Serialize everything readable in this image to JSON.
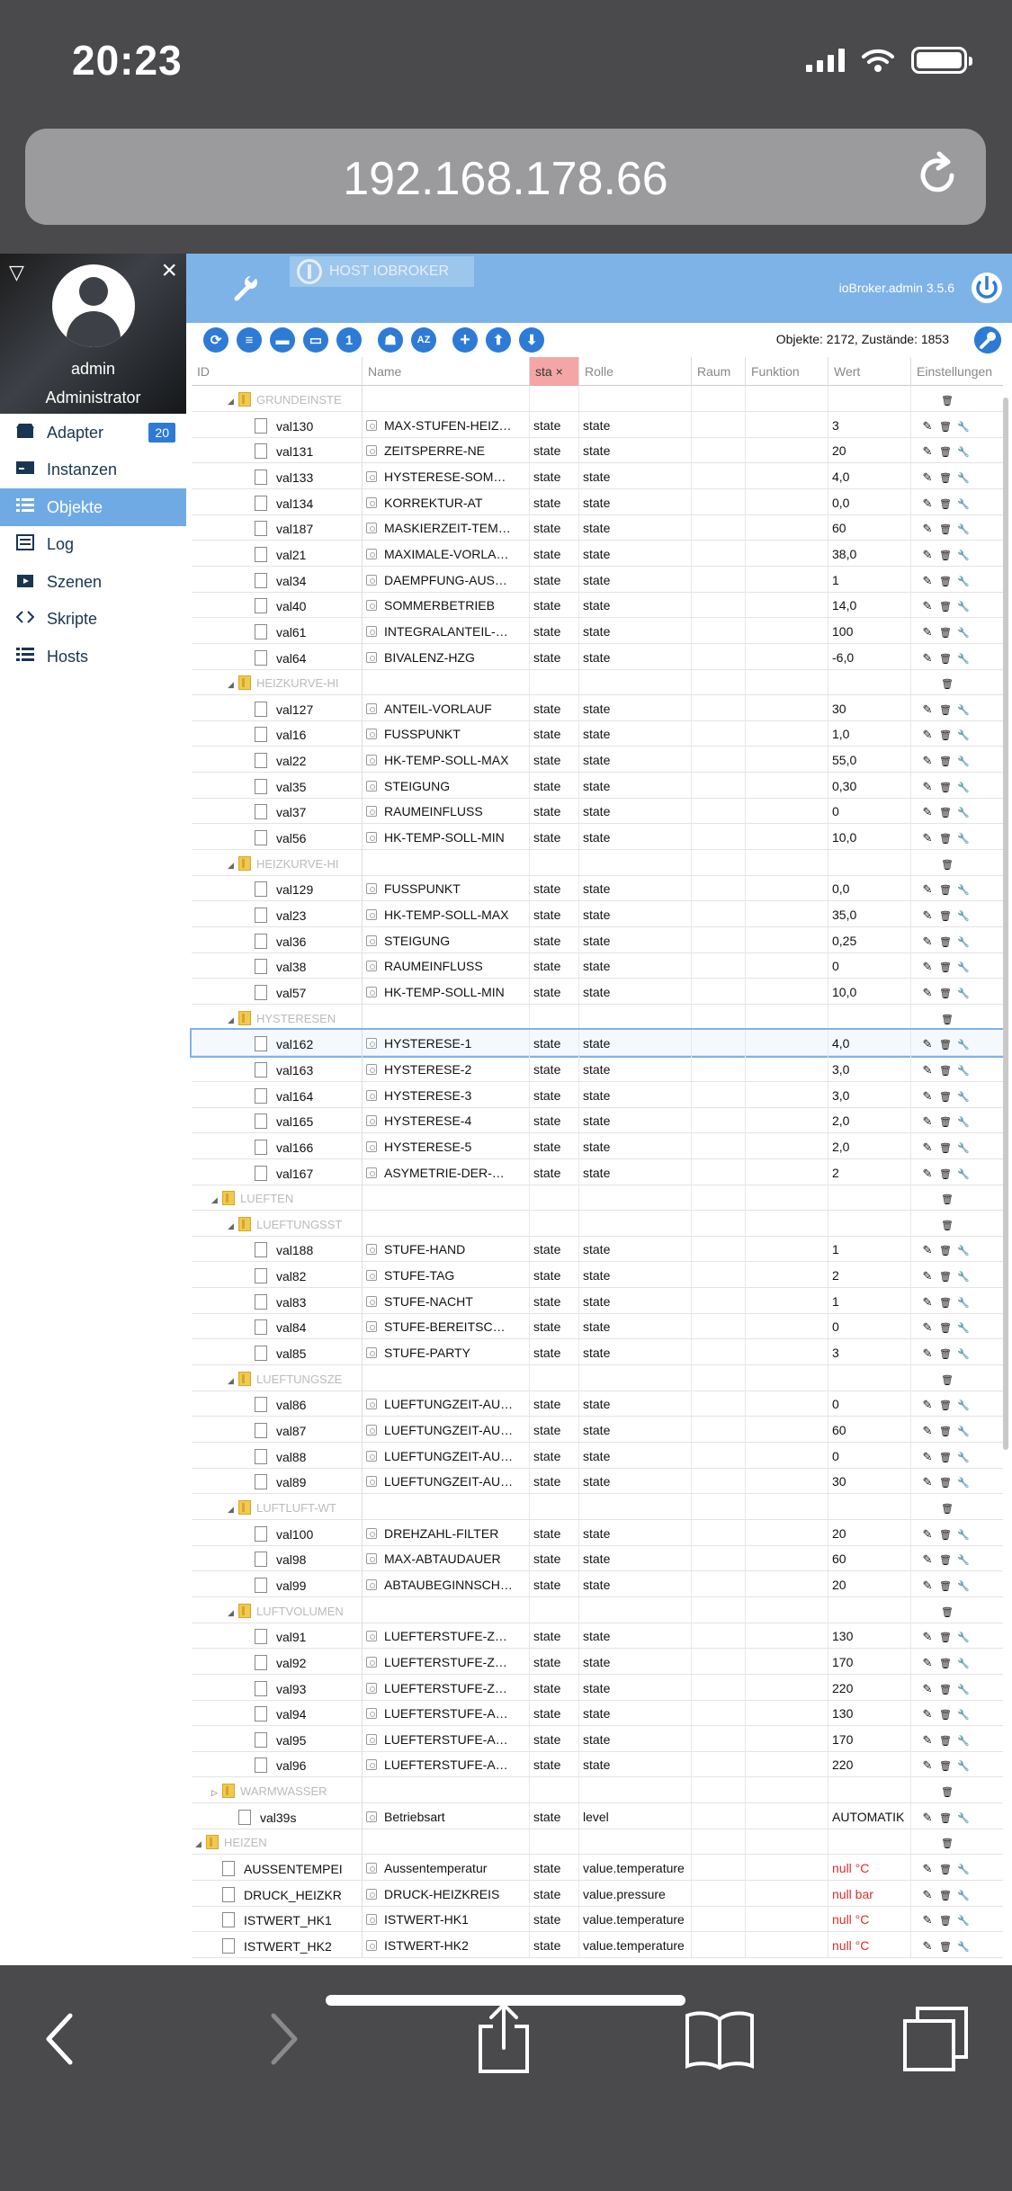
{
  "status": {
    "time": "20:23"
  },
  "browser": {
    "url": "192.168.178.66"
  },
  "sidebar": {
    "user_name": "admin",
    "user_role": "Administrator",
    "items": [
      {
        "label": "Adapter",
        "icon": "adapter-icon",
        "badge": "20"
      },
      {
        "label": "Instanzen",
        "icon": "instances-icon"
      },
      {
        "label": "Objekte",
        "icon": "objects-list-icon"
      },
      {
        "label": "Log",
        "icon": "log-icon"
      },
      {
        "label": "Szenen",
        "icon": "scenes-icon"
      },
      {
        "label": "Skripte",
        "icon": "code-icon"
      },
      {
        "label": "Hosts",
        "icon": "hosts-icon"
      }
    ],
    "active_item": "Objekte"
  },
  "topbar": {
    "host_label": "HOST IOBROKER",
    "app_version": "ioBroker.admin 3.5.6"
  },
  "toolbar": {
    "objects_count": "Objekte: 2172, Zustände: 1853"
  },
  "table": {
    "columns": [
      "ID",
      "Name",
      "sta",
      "Rolle",
      "Raum",
      "Funktion",
      "Wert",
      "Einstellungen"
    ],
    "filter_type_value": "sta",
    "rows": [
      {
        "kind": "folder",
        "level": 2,
        "id": "GRUNDEINSTE",
        "expanded": true
      },
      {
        "kind": "state",
        "level": 3,
        "id": "val130",
        "name": "MAX-STUFEN-HEIZ…",
        "type": "state",
        "role": "state",
        "value": "3"
      },
      {
        "kind": "state",
        "level": 3,
        "id": "val131",
        "name": "ZEITSPERRE-NE",
        "type": "state",
        "role": "state",
        "value": "20"
      },
      {
        "kind": "state",
        "level": 3,
        "id": "val133",
        "name": "HYSTERESE-SOM…",
        "type": "state",
        "role": "state",
        "value": "4,0"
      },
      {
        "kind": "state",
        "level": 3,
        "id": "val134",
        "name": "KORREKTUR-AT",
        "type": "state",
        "role": "state",
        "value": "0,0"
      },
      {
        "kind": "state",
        "level": 3,
        "id": "val187",
        "name": "MASKIERZEIT-TEM…",
        "type": "state",
        "role": "state",
        "value": "60"
      },
      {
        "kind": "state",
        "level": 3,
        "id": "val21",
        "name": "MAXIMALE-VORLA…",
        "type": "state",
        "role": "state",
        "value": "38,0"
      },
      {
        "kind": "state",
        "level": 3,
        "id": "val34",
        "name": "DAEMPFUNG-AUS…",
        "type": "state",
        "role": "state",
        "value": "1"
      },
      {
        "kind": "state",
        "level": 3,
        "id": "val40",
        "name": "SOMMERBETRIEB",
        "type": "state",
        "role": "state",
        "value": "14,0"
      },
      {
        "kind": "state",
        "level": 3,
        "id": "val61",
        "name": "INTEGRALANTEIL-…",
        "type": "state",
        "role": "state",
        "value": "100"
      },
      {
        "kind": "state",
        "level": 3,
        "id": "val64",
        "name": "BIVALENZ-HZG",
        "type": "state",
        "role": "state",
        "value": "-6,0"
      },
      {
        "kind": "folder",
        "level": 2,
        "id": "HEIZKURVE-HI",
        "expanded": true
      },
      {
        "kind": "state",
        "level": 3,
        "id": "val127",
        "name": "ANTEIL-VORLAUF",
        "type": "state",
        "role": "state",
        "value": "30"
      },
      {
        "kind": "state",
        "level": 3,
        "id": "val16",
        "name": "FUSSPUNKT",
        "type": "state",
        "role": "state",
        "value": "1,0"
      },
      {
        "kind": "state",
        "level": 3,
        "id": "val22",
        "name": "HK-TEMP-SOLL-MAX",
        "type": "state",
        "role": "state",
        "value": "55,0"
      },
      {
        "kind": "state",
        "level": 3,
        "id": "val35",
        "name": "STEIGUNG",
        "type": "state",
        "role": "state",
        "value": "0,30"
      },
      {
        "kind": "state",
        "level": 3,
        "id": "val37",
        "name": "RAUMEINFLUSS",
        "type": "state",
        "role": "state",
        "value": "0"
      },
      {
        "kind": "state",
        "level": 3,
        "id": "val56",
        "name": "HK-TEMP-SOLL-MIN",
        "type": "state",
        "role": "state",
        "value": "10,0"
      },
      {
        "kind": "folder",
        "level": 2,
        "id": "HEIZKURVE-HI",
        "expanded": true
      },
      {
        "kind": "state",
        "level": 3,
        "id": "val129",
        "name": "FUSSPUNKT",
        "type": "state",
        "role": "state",
        "value": "0,0"
      },
      {
        "kind": "state",
        "level": 3,
        "id": "val23",
        "name": "HK-TEMP-SOLL-MAX",
        "type": "state",
        "role": "state",
        "value": "35,0"
      },
      {
        "kind": "state",
        "level": 3,
        "id": "val36",
        "name": "STEIGUNG",
        "type": "state",
        "role": "state",
        "value": "0,25"
      },
      {
        "kind": "state",
        "level": 3,
        "id": "val38",
        "name": "RAUMEINFLUSS",
        "type": "state",
        "role": "state",
        "value": "0"
      },
      {
        "kind": "state",
        "level": 3,
        "id": "val57",
        "name": "HK-TEMP-SOLL-MIN",
        "type": "state",
        "role": "state",
        "value": "10,0"
      },
      {
        "kind": "folder",
        "level": 2,
        "id": "HYSTERESEN",
        "expanded": true
      },
      {
        "kind": "state",
        "level": 3,
        "id": "val162",
        "name": "HYSTERESE-1",
        "type": "state",
        "role": "state",
        "value": "4,0",
        "selected": true
      },
      {
        "kind": "state",
        "level": 3,
        "id": "val163",
        "name": "HYSTERESE-2",
        "type": "state",
        "role": "state",
        "value": "3,0"
      },
      {
        "kind": "state",
        "level": 3,
        "id": "val164",
        "name": "HYSTERESE-3",
        "type": "state",
        "role": "state",
        "value": "3,0"
      },
      {
        "kind": "state",
        "level": 3,
        "id": "val165",
        "name": "HYSTERESE-4",
        "type": "state",
        "role": "state",
        "value": "2,0"
      },
      {
        "kind": "state",
        "level": 3,
        "id": "val166",
        "name": "HYSTERESE-5",
        "type": "state",
        "role": "state",
        "value": "2,0"
      },
      {
        "kind": "state",
        "level": 3,
        "id": "val167",
        "name": "ASYMETRIE-DER-…",
        "type": "state",
        "role": "state",
        "value": "2"
      },
      {
        "kind": "folder",
        "level": 1,
        "id": "LUEFTEN",
        "expanded": true
      },
      {
        "kind": "folder",
        "level": 2,
        "id": "LUEFTUNGSST",
        "expanded": true
      },
      {
        "kind": "state",
        "level": 3,
        "id": "val188",
        "name": "STUFE-HAND",
        "type": "state",
        "role": "state",
        "value": "1"
      },
      {
        "kind": "state",
        "level": 3,
        "id": "val82",
        "name": "STUFE-TAG",
        "type": "state",
        "role": "state",
        "value": "2"
      },
      {
        "kind": "state",
        "level": 3,
        "id": "val83",
        "name": "STUFE-NACHT",
        "type": "state",
        "role": "state",
        "value": "1"
      },
      {
        "kind": "state",
        "level": 3,
        "id": "val84",
        "name": "STUFE-BEREITSC…",
        "type": "state",
        "role": "state",
        "value": "0"
      },
      {
        "kind": "state",
        "level": 3,
        "id": "val85",
        "name": "STUFE-PARTY",
        "type": "state",
        "role": "state",
        "value": "3"
      },
      {
        "kind": "folder",
        "level": 2,
        "id": "LUEFTUNGSZE",
        "expanded": true
      },
      {
        "kind": "state",
        "level": 3,
        "id": "val86",
        "name": "LUEFTUNGZEIT-AU…",
        "type": "state",
        "role": "state",
        "value": "0"
      },
      {
        "kind": "state",
        "level": 3,
        "id": "val87",
        "name": "LUEFTUNGZEIT-AU…",
        "type": "state",
        "role": "state",
        "value": "60"
      },
      {
        "kind": "state",
        "level": 3,
        "id": "val88",
        "name": "LUEFTUNGZEIT-AU…",
        "type": "state",
        "role": "state",
        "value": "0"
      },
      {
        "kind": "state",
        "level": 3,
        "id": "val89",
        "name": "LUEFTUNGZEIT-AU…",
        "type": "state",
        "role": "state",
        "value": "30"
      },
      {
        "kind": "folder",
        "level": 2,
        "id": "LUFTLUFT-WT",
        "expanded": true
      },
      {
        "kind": "state",
        "level": 3,
        "id": "val100",
        "name": "DREHZAHL-FILTER",
        "type": "state",
        "role": "state",
        "value": "20"
      },
      {
        "kind": "state",
        "level": 3,
        "id": "val98",
        "name": "MAX-ABTAUDAUER",
        "type": "state",
        "role": "state",
        "value": "60"
      },
      {
        "kind": "state",
        "level": 3,
        "id": "val99",
        "name": "ABTAUBEGINNSCH…",
        "type": "state",
        "role": "state",
        "value": "20"
      },
      {
        "kind": "folder",
        "level": 2,
        "id": "LUFTVOLUMEN",
        "expanded": true
      },
      {
        "kind": "state",
        "level": 3,
        "id": "val91",
        "name": "LUEFTERSTUFE-Z…",
        "type": "state",
        "role": "state",
        "value": "130"
      },
      {
        "kind": "state",
        "level": 3,
        "id": "val92",
        "name": "LUEFTERSTUFE-Z…",
        "type": "state",
        "role": "state",
        "value": "170"
      },
      {
        "kind": "state",
        "level": 3,
        "id": "val93",
        "name": "LUEFTERSTUFE-Z…",
        "type": "state",
        "role": "state",
        "value": "220"
      },
      {
        "kind": "state",
        "level": 3,
        "id": "val94",
        "name": "LUEFTERSTUFE-A…",
        "type": "state",
        "role": "state",
        "value": "130"
      },
      {
        "kind": "state",
        "level": 3,
        "id": "val95",
        "name": "LUEFTERSTUFE-A…",
        "type": "state",
        "role": "state",
        "value": "170"
      },
      {
        "kind": "state",
        "level": 3,
        "id": "val96",
        "name": "LUEFTERSTUFE-A…",
        "type": "state",
        "role": "state",
        "value": "220"
      },
      {
        "kind": "folder",
        "level": 1,
        "id": "WARMWASSER",
        "expanded": false
      },
      {
        "kind": "state",
        "level": 2,
        "id": "val39s",
        "name": "Betriebsart",
        "type": "state",
        "role": "level",
        "value": "AUTOMATIK"
      },
      {
        "kind": "folder",
        "level": 0,
        "id": "HEIZEN",
        "expanded": true
      },
      {
        "kind": "state",
        "level": 1,
        "id": "AUSSENTEMPEI",
        "name": "Aussentemperatur",
        "type": "state",
        "role": "value.temperature",
        "value": "null °C",
        "value_color": "red"
      },
      {
        "kind": "state",
        "level": 1,
        "id": "DRUCK_HEIZKR",
        "name": "DRUCK-HEIZKREIS",
        "type": "state",
        "role": "value.pressure",
        "value": "null bar",
        "value_color": "red"
      },
      {
        "kind": "state",
        "level": 1,
        "id": "ISTWERT_HK1",
        "name": "ISTWERT-HK1",
        "type": "state",
        "role": "value.temperature",
        "value": "null °C",
        "value_color": "red"
      },
      {
        "kind": "state",
        "level": 1,
        "id": "ISTWERT_HK2",
        "name": "ISTWERT-HK2",
        "type": "state",
        "role": "value.temperature",
        "value": "null °C",
        "value_color": "red"
      }
    ]
  },
  "colors": {
    "accent": "#2d7bd5",
    "topbar": "#7eb3e8",
    "active_nav": "#70aae4",
    "null_value": "#e02b2b"
  }
}
